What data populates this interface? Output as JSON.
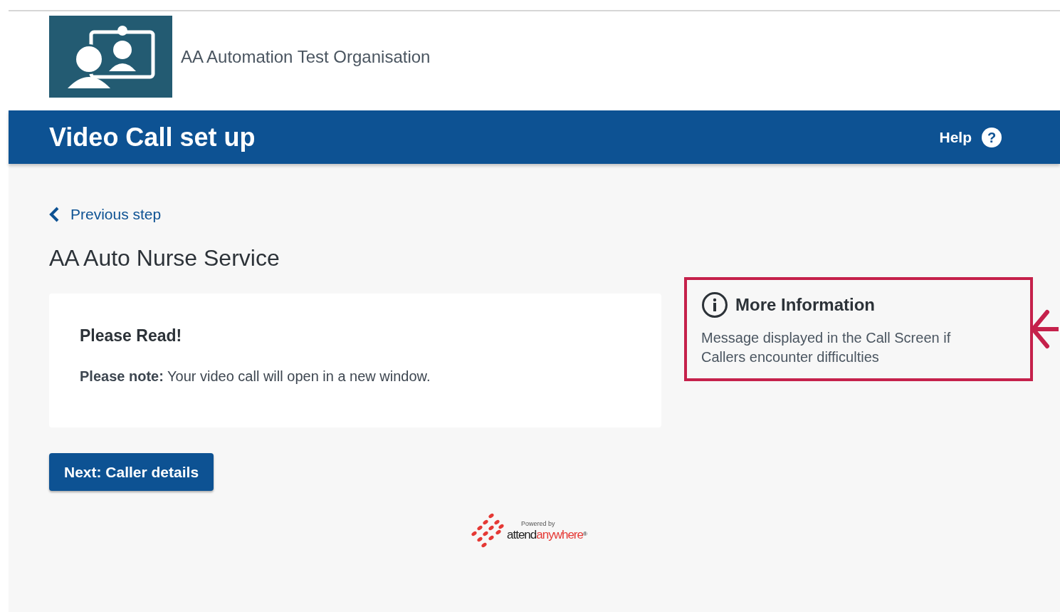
{
  "header": {
    "organisation": "AA Automation Test Organisation"
  },
  "title_bar": {
    "title": "Video Call set up",
    "help": "Help",
    "help_icon": "?"
  },
  "back_link": "Previous step",
  "service_name": "AA Auto Nurse Service",
  "notice": {
    "heading": "Please Read!",
    "text": "**Please note:** Your video call will open in a new window."
  },
  "more_info": {
    "heading": "More Information",
    "text": "Message displayed in the Call Screen if Callers encounter difficulties",
    "highlighted": true
  },
  "next_button": "Next: Caller details",
  "footer": {
    "powered_by": "Powered by",
    "brand": [
      "attend",
      "anywhere"
    ],
    "mark": "®"
  }
}
